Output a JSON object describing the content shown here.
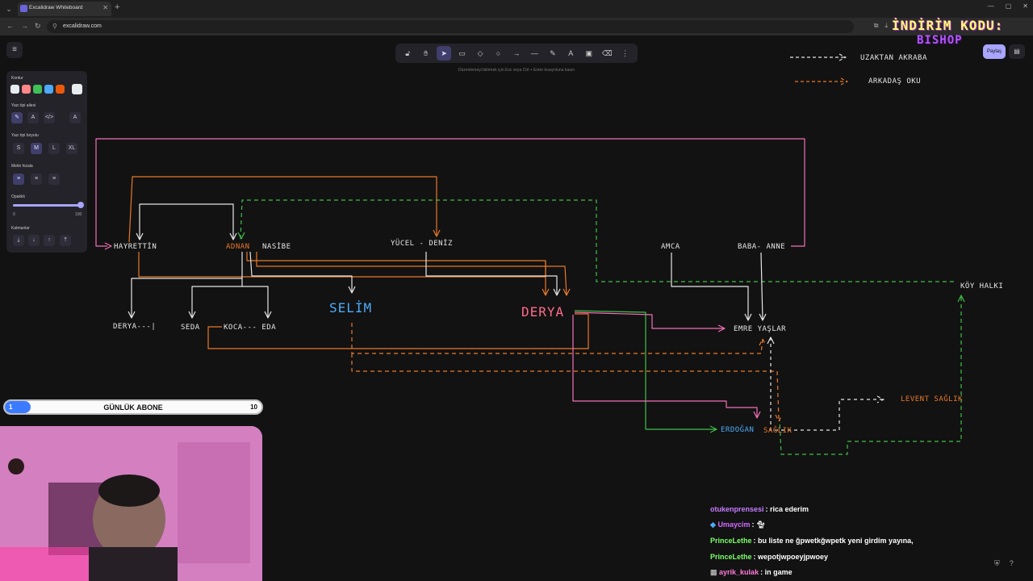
{
  "browser": {
    "tab_title": "Excalidraw Whiteboard",
    "url": "excalidraw.com"
  },
  "toolbar": {
    "hint": "Düzenlemeyi bitirmek için Esc veya Ctrl + Enter kısayoluna basın",
    "tools": [
      "lock-icon",
      "hand-icon",
      "selection-icon",
      "rectangle-icon",
      "diamond-icon",
      "ellipse-icon",
      "arrow-icon",
      "line-icon",
      "pencil-icon",
      "text-icon",
      "image-icon",
      "eraser-icon",
      "more-icon"
    ],
    "active_tool": "selection-icon",
    "share_label": "Paylaş"
  },
  "props": {
    "stroke_label": "Kontur",
    "stroke_colors": [
      "#e9ecef",
      "#ff8787",
      "#40c057",
      "#4dabf7",
      "#e8590c"
    ],
    "selected_color": "#e9ecef",
    "font_family_label": "Yazı tipi ailesi",
    "font_size_label": "Yazı tipi boyutu",
    "sizes": [
      "S",
      "M",
      "L",
      "XL"
    ],
    "active_size": "M",
    "align_label": "Metin hizala",
    "opacity_label": "Opaklık",
    "opacity_min": "0",
    "opacity_max": "100",
    "opacity_value": 1.0,
    "layers_label": "Katmanlar"
  },
  "legend": {
    "item1": "UZAKTAN AKRABA",
    "item2": "ARKADAŞ OKU"
  },
  "nodes": {
    "hayrettin": "HAYRETTİN",
    "adnan": "ADNAN",
    "nasibe": "NASİBE",
    "yucel": "YÜCEL - DENİZ",
    "amca": "AMCA",
    "baba": "BABA- ANNE",
    "koy": "KÖY HALKI",
    "derya_small": "DERYA---|",
    "seda": "SEDA",
    "koca": "KOCA--- EDA",
    "selim": "SELİM",
    "derya_big": "DERYA",
    "emre": "EMRE YAŞLAR",
    "levent": "LEVENT SAĞLIK",
    "erdogan": "ERDOĞAN",
    "saglik": "SAĞLIK"
  },
  "promo": {
    "line1": "İNDİRİM KODU:",
    "line2": "BISHOP"
  },
  "sub_goal": {
    "title": "GÜNLÜK ABONE",
    "current": "1",
    "goal": "10",
    "progress": 0.1
  },
  "chat": [
    {
      "user": "otukenprensesi",
      "color": "#c77dff",
      "message": "rica ederim"
    },
    {
      "user": "Umaycim",
      "color": "#d16bff",
      "message": ""
    },
    {
      "user": "PrinceLethe",
      "color": "#7dff6b",
      "message": "bu liste ne ğpwetkğwpetk yeni girdim yayına,"
    },
    {
      "user": "PrinceLethe",
      "color": "#7dff6b",
      "message": "wepotjwpoeyjpwoey"
    },
    {
      "user": "ayrik_kulak",
      "color": "#ff7ad9",
      "message": "in game"
    }
  ]
}
